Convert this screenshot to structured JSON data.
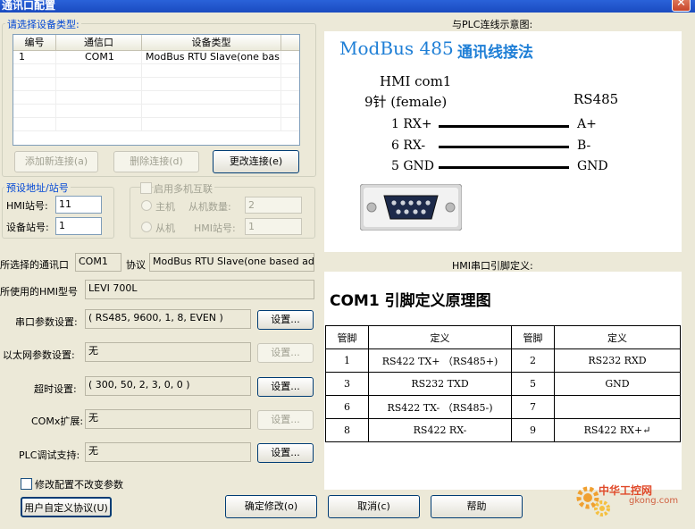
{
  "window": {
    "title": "通讯口配置",
    "close_glyph": "✕"
  },
  "device_group": {
    "title": "请选择设备类型:",
    "columns": [
      "编号",
      "通信口",
      "设备类型"
    ],
    "rows": [
      {
        "id": "1",
        "port": "COM1",
        "device": "ModBus RTU Slave(one bas..."
      }
    ],
    "buttons": {
      "add": "添加新连接(a)",
      "delete": "删除连接(d)",
      "change": "更改连接(e)"
    }
  },
  "station": {
    "title": "预设地址/站号",
    "hmi_station_label": "HMI站号:",
    "hmi_station_value": "11",
    "device_station_label": "设备站号:",
    "device_station_value": "1"
  },
  "multi": {
    "title": "启用多机互联",
    "master_label": "主机",
    "slave_count_label": "从机数量:",
    "slave_count_value": "2",
    "slave_label": "从机",
    "hmi_station_label": "HMI站号:",
    "hmi_station_value": "1"
  },
  "port_info": {
    "port_label": "所选择的通讯口",
    "port_value": "COM1",
    "protocol_label": "协议",
    "protocol_value": "ModBus RTU Slave(one based addr)",
    "hmi_model_label": "所使用的HMI型号",
    "hmi_model_value": "LEVI 700L"
  },
  "settings": {
    "serial_label": "串口参数设置:",
    "serial_value": "( RS485, 9600, 1, 8, EVEN )",
    "ethernet_label": "以太网参数设置:",
    "ethernet_value": "无",
    "timeout_label": "超时设置:",
    "timeout_value": "( 300, 50, 2, 3, 0, 0 )",
    "comx_label": "COMx扩展:",
    "comx_value": "无",
    "plc_debug_label": "PLC调试支持:",
    "plc_debug_value": "无",
    "settings_button": "设置..."
  },
  "keep_params_label": "修改配置不改变参数",
  "footer_buttons": {
    "user_protocol": "用户自定义协议(U)",
    "confirm": "确定修改(o)",
    "cancel": "取消(c)",
    "help": "帮助"
  },
  "diagram": {
    "caption": "与PLC连线示意图:",
    "title_en": "ModBus 485",
    "title_cn": "通讯线接法",
    "hmi_label": "HMI com1",
    "pin_label": "9针 (female)",
    "rs485_label": "RS485",
    "left_pins": [
      "1 RX+",
      "6 RX-",
      "5 GND"
    ],
    "right_pins": [
      "A+",
      "B-",
      "GND"
    ]
  },
  "pin_def": {
    "caption": "HMI串口引脚定义:",
    "title": "COM1 引脚定义原理图",
    "headers": [
      "管脚",
      "定义",
      "管脚",
      "定义"
    ],
    "rows": [
      [
        "1",
        "RS422 TX+ （RS485+)",
        "2",
        "RS232 RXD"
      ],
      [
        "3",
        "RS232 TXD",
        "5",
        "GND"
      ],
      [
        "6",
        "RS422 TX- （RS485-)",
        "7",
        ""
      ],
      [
        "8",
        "RS422 RX-",
        "9",
        "RS422 RX+↵"
      ]
    ]
  },
  "watermark": {
    "cn": "中华工控网",
    "en": "gkong.com"
  },
  "colors": {
    "accent": "#0046d5",
    "diagram_title": "#1f7fd6",
    "titlebar": "#2a62d9"
  }
}
